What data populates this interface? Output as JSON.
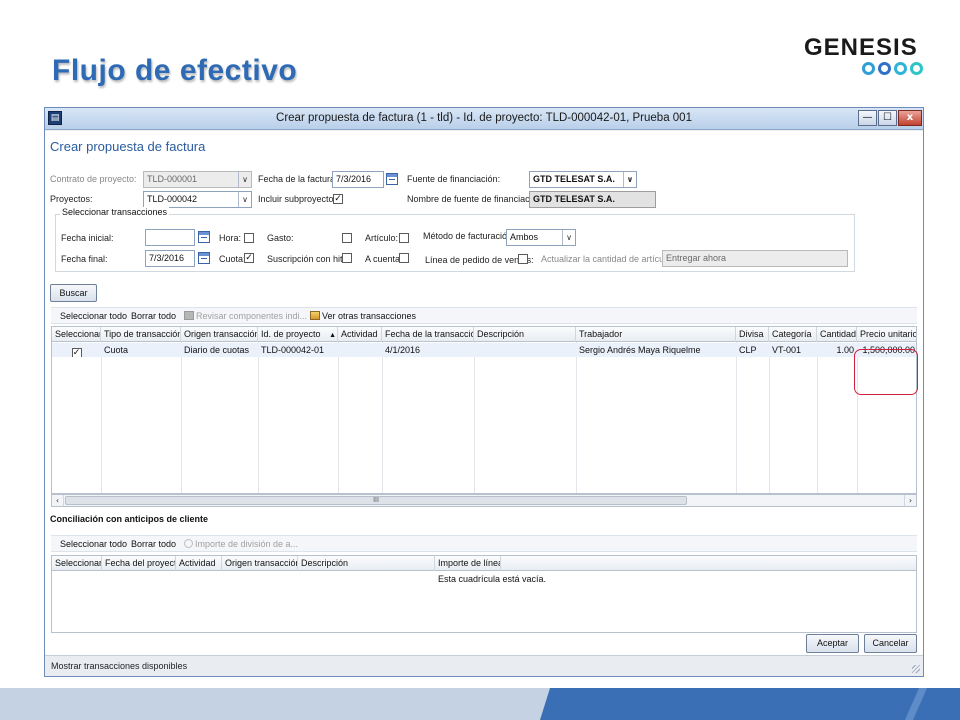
{
  "slide": {
    "title": "Flujo de efectivo",
    "logo_text": "GENESIS"
  },
  "window": {
    "title": "Crear propuesta de factura (1 - tld) - Id. de proyecto: TLD-000042-01, Prueba 001",
    "min_label": "—",
    "max_label": "☐",
    "close_label": "x"
  },
  "form": {
    "title": "Crear propuesta de factura",
    "contrato_label": "Contrato de proyecto:",
    "contrato_value": "TLD-000001",
    "proyectos_label": "Proyectos:",
    "proyectos_value": "TLD-000042",
    "fecha_factura_label": "Fecha de la factura:",
    "fecha_factura_value": "7/3/2016",
    "incluir_label": "Incluir subproyectos:",
    "fuente_label": "Fuente de financiación:",
    "fuente_value": "GTD TELESAT S.A.",
    "nombre_fuente_label": "Nombre de fuente de financiación:",
    "nombre_fuente_value": "GTD TELESAT S.A."
  },
  "select_tx": {
    "title": "Seleccionar transacciones",
    "fecha_inicial_label": "Fecha inicial:",
    "fecha_inicial_value": "",
    "fecha_final_label": "Fecha final:",
    "fecha_final_value": "7/3/2016",
    "hora_label": "Hora:",
    "cuota_label": "Cuota:",
    "gasto_label": "Gasto:",
    "suscripcion_label": "Suscripción con hito:",
    "articulo_label": "Artículo:",
    "a_cuenta_label": "A cuenta:",
    "metodo_label": "Método de facturación:",
    "metodo_value": "Ambos",
    "linea_pedido_label": "Línea de pedido de ventas:",
    "actualizar_label": "Actualizar la cantidad de artículos:",
    "actualizar_value": "Entregar ahora"
  },
  "buscar_label": "Buscar",
  "toolbar1": {
    "select_all": "Seleccionar todo",
    "clear_all": "Borrar todo",
    "review": "Revisar componentes indi...",
    "other_tx": "Ver otras transacciones"
  },
  "grid1": {
    "headers": [
      "Seleccionar",
      "Tipo de transacción",
      "Origen transacción",
      "Id. de proyecto",
      "Actividad",
      "Fecha de la transacción",
      "Descripción",
      "Trabajador",
      "Divisa",
      "Categoría",
      "Cantidad",
      "Precio unitario"
    ],
    "sort_indicator": "▲",
    "rows": [
      {
        "select": "✓",
        "tipo": "Cuota",
        "origen": "Diario de cuotas",
        "id_proyecto": "TLD-000042-01",
        "actividad": "",
        "fecha": "4/1/2016",
        "descripcion": "",
        "trabajador": "Sergio Andrés Maya Riquelme",
        "divisa": "CLP",
        "categoria": "VT-001",
        "cantidad": "1.00",
        "precio": "1,500,000.00"
      }
    ],
    "scroll_left": "‹",
    "scroll_right": "›",
    "scroll_thumb": "III"
  },
  "anticipos": {
    "title": "Conciliación con anticipos de cliente",
    "select_all": "Seleccionar todo",
    "clear_all": "Borrar todo",
    "split": "Importe de división de a...",
    "headers": [
      "Seleccionar",
      "Fecha del proyecto",
      "Actividad",
      "Origen transacción",
      "Descripción",
      "Importe de línea"
    ],
    "empty": "Esta cuadrícula está vacía."
  },
  "actions": {
    "accept": "Aceptar",
    "cancel": "Cancelar"
  },
  "status": {
    "text": "Mostrar transacciones disponibles"
  },
  "colors": {
    "title_blue": "#2f6ab4",
    "highlight_red": "#d0213c",
    "band_dark": "#3a6fb5",
    "band_light": "#c5d2e3"
  }
}
